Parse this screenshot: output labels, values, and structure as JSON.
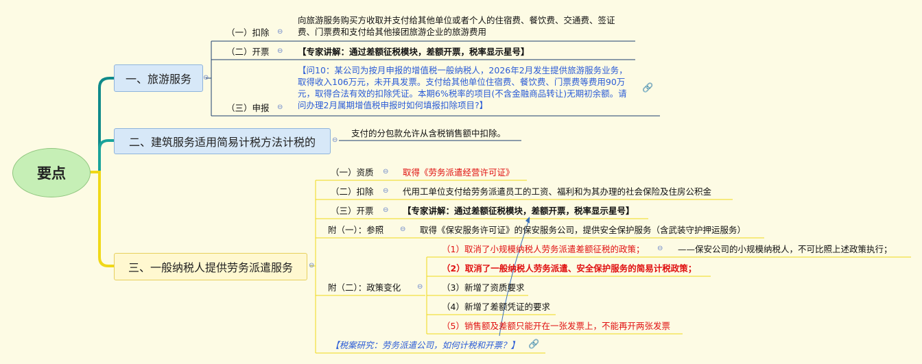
{
  "root": {
    "label": "要点"
  },
  "branch1": {
    "label": "一、旅游服务",
    "deduct": {
      "label": "（一）扣除",
      "text1": "向旅游服务购买方收取并支付给其他单位或者个人的住宿费、餐饮费、交通费、签证",
      "text2": "费、门票费和支付给其他接团旅游企业的旅游费用"
    },
    "invoice": {
      "label": "（二）开票",
      "text": "【专家讲解：通过差额征税模块，差额开票，税率显示星号】"
    },
    "declare": {
      "label": "（三）申报",
      "lines": [
        "【问10：某公司为按月申报的增值税一般纳税人，2026年2月发生提供旅游服务业务，",
        "取得收入106万元，未开具发票。支付给其他单位住宿费、餐饮费、门票费等费用90万",
        "元，取得合法有效的扣除凭证。本期6%税率的项目(不含金融商品转让)无期初余额。请",
        "问办理2月属期增值税申报时如何填报扣除项目?】"
      ]
    }
  },
  "branch2": {
    "label": "二、建筑服务适用简易计税方法计税的",
    "text": "支付的分包款允许从含税销售额中扣除。"
  },
  "branch3": {
    "label": "三、一般纳税人提供劳务派遣服务",
    "qual": {
      "label": "（一）资质",
      "text": "取得《劳务派遣经营许可证》"
    },
    "deduct": {
      "label": "（二）扣除",
      "text": "代用工单位支付给劳务派遣员工的工资、福利和为其办理的社会保险及住房公积金"
    },
    "invoice": {
      "label": "（三）开票",
      "text": "【专家讲解：通过差额征税模块，差额开票，税率显示星号】"
    },
    "ref": {
      "label": "附（一）：参照",
      "text": "取得《保安服务许可证》的保安服务公司，提供安全保护服务（含武装守护押运服务）"
    },
    "policy": {
      "label": "附（二）：政策变化",
      "item1": "（1）取消了小规模纳税人劳务派遣差额征税的政策；",
      "item1_note": "——保安公司的小规模纳税人，不可比照上述政策执行；",
      "item2": "（2）取消了一般纳税人劳务派遣、安全保护服务的简易计税政策；",
      "item3": "（3）新增了资质要求",
      "item4": "（4）新增了差额凭证的要求",
      "item5": "（5）销售额及差额只能开在一张发票上，不能再开两张发票"
    },
    "case": {
      "text": "【税案研究：劳务派遣公司，如何计税和开票？】"
    }
  },
  "icons": {
    "collapse": "⊖",
    "link": "🔗"
  },
  "colors": {
    "root_fill": "#c6efb6",
    "blue_box": "#d7e8f8",
    "yellow_box": "#fff8d0",
    "red_text": "#e01010",
    "blue_text": "#2a5bd6",
    "teal_line": "#0f8a8a",
    "yellow_line": "#f0d818",
    "navy_line": "#1c3e6e"
  }
}
